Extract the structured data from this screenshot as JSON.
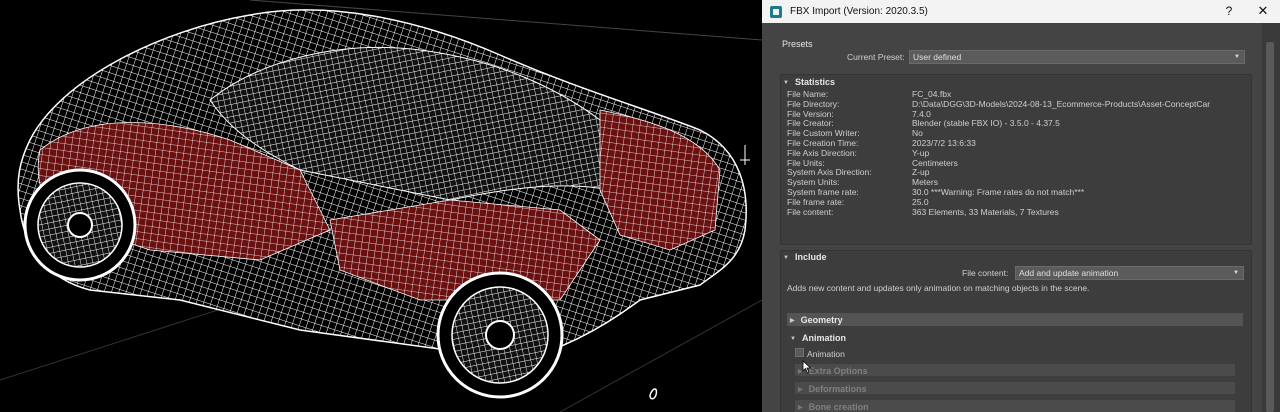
{
  "dialog": {
    "title": "FBX Import (Version: 2020.3.5)",
    "help_label": "?",
    "close_label": "✕"
  },
  "presets": {
    "heading": "Presets",
    "current_label": "Current Preset:",
    "current_value": "User defined"
  },
  "statistics": {
    "heading": "Statistics",
    "rows": [
      {
        "label": "File Name:",
        "value": "FC_04.fbx"
      },
      {
        "label": "File Directory:",
        "value": "D:\\Data\\DGG\\3D-Models\\2024-08-13_Ecommerce-Products\\Asset-ConceptCar"
      },
      {
        "label": "File Version:",
        "value": "7.4.0"
      },
      {
        "label": "File Creator:",
        "value": "Blender (stable FBX IO) - 3.5.0 - 4.37.5"
      },
      {
        "label": "File Custom Writer:",
        "value": "No"
      },
      {
        "label": "File Creation Time:",
        "value": "2023/7/2  13:6:33"
      },
      {
        "label": "File Axis Direction:",
        "value": "Y-up"
      },
      {
        "label": "File Units:",
        "value": "Centimeters"
      },
      {
        "label": "System Axis Direction:",
        "value": "Z-up"
      },
      {
        "label": "System Units:",
        "value": "Meters"
      },
      {
        "label": "System frame rate:",
        "value": "30.0   ***Warning: Frame rates do not match***"
      },
      {
        "label": "File frame rate:",
        "value": "25.0"
      },
      {
        "label": "File content:",
        "value": "363 Elements,    33 Materials,    7 Textures"
      }
    ]
  },
  "include": {
    "heading": "Include",
    "file_content_label": "File content:",
    "file_content_value": "Add and update animation",
    "description": "Adds new content and updates only animation on matching objects in the scene.",
    "geometry_heading": "Geometry",
    "animation_heading": "Animation",
    "animation_checkbox_label": "Animation",
    "extra_options": "Extra Options",
    "deformations": "Deformations",
    "bone_creation": "Bone creation"
  },
  "icons": {
    "expand": "triangle-down-icon",
    "collapsed": "triangle-right-icon",
    "dropdown": "chevron-down-icon"
  },
  "colors": {
    "dialog_bg": "#444444",
    "titlebar_bg": "#f3f3f3",
    "wire_white": "#ffffff",
    "wire_red": "#8b1a1a"
  }
}
